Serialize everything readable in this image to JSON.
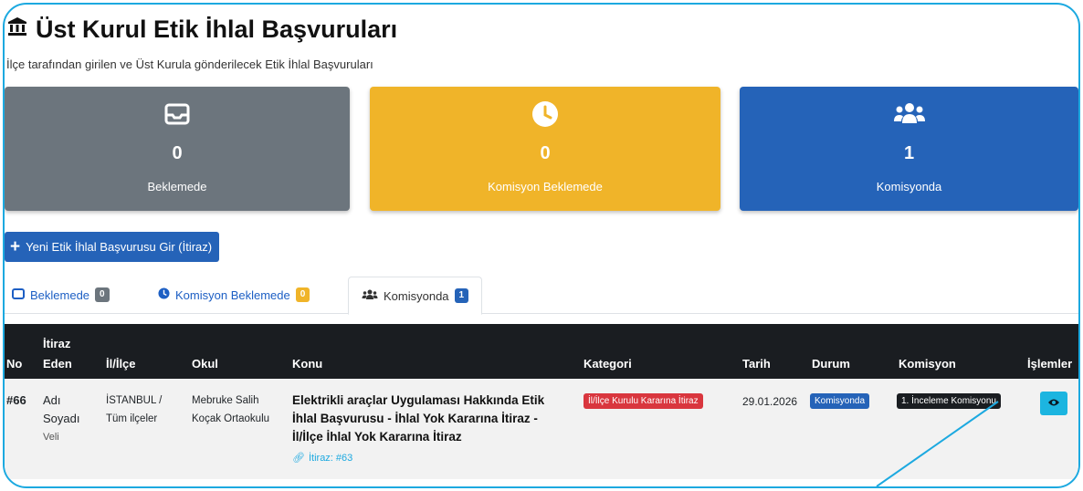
{
  "page": {
    "title": "Üst Kurul Etik İhlal Başvuruları",
    "subtitle": "İlçe tarafından girilen ve Üst Kurula gönderilecek Etik İhlal Başvuruları"
  },
  "cards": [
    {
      "value": "0",
      "label": "Beklemede",
      "icon": "inbox-icon"
    },
    {
      "value": "0",
      "label": "Komisyon Beklemede",
      "icon": "clock-icon"
    },
    {
      "value": "1",
      "label": "Komisyonda",
      "icon": "users-icon"
    }
  ],
  "new_button": {
    "label": "Yeni Etik İhlal Başvurusu Gir (İtiraz)"
  },
  "tabs": [
    {
      "label": "Beklemede",
      "count": "0"
    },
    {
      "label": "Komisyon Beklemede",
      "count": "0"
    },
    {
      "label": "Komisyonda",
      "count": "1"
    }
  ],
  "table": {
    "headers": {
      "no": "No",
      "itiraz1": "İtiraz",
      "itiraz2": "Eden",
      "ililce": "İl/İlçe",
      "okul": "Okul",
      "konu": "Konu",
      "kategori": "Kategori",
      "tarih": "Tarih",
      "durum": "Durum",
      "komisyon": "Komisyon",
      "islemler": "İşlemler"
    },
    "row": {
      "no": "#66",
      "eden1": "Adı",
      "eden2": "Soyadı",
      "eden3": "Veli",
      "il1": "İSTANBUL /",
      "il2": "Tüm ilçeler",
      "okul1": "Mebruke Salih",
      "okul2": "Koçak Ortaokulu",
      "konu1": "Elektrikli araçlar Uygulaması Hakkında Etik",
      "konu2": "İhlal Başvurusu - İhlal Yok Kararına İtiraz -",
      "konu3": "İl/İlçe İhlal Yok Kararına İtiraz",
      "itiraz_link": "İtiraz: #63",
      "kategori": "İl/İlçe Kurulu Kararına İtiraz",
      "tarih": "29.01.2026",
      "durum": "Komisyonda",
      "komisyon": "1. İnceleme Komisyonu"
    }
  },
  "colors": {
    "frame": "#1ca9e0",
    "gray": "#6c757d",
    "yellow": "#f0b429",
    "blue": "#2563b8",
    "dark": "#1a1d21",
    "danger": "#d9363e",
    "info": "#1cb5e0"
  }
}
